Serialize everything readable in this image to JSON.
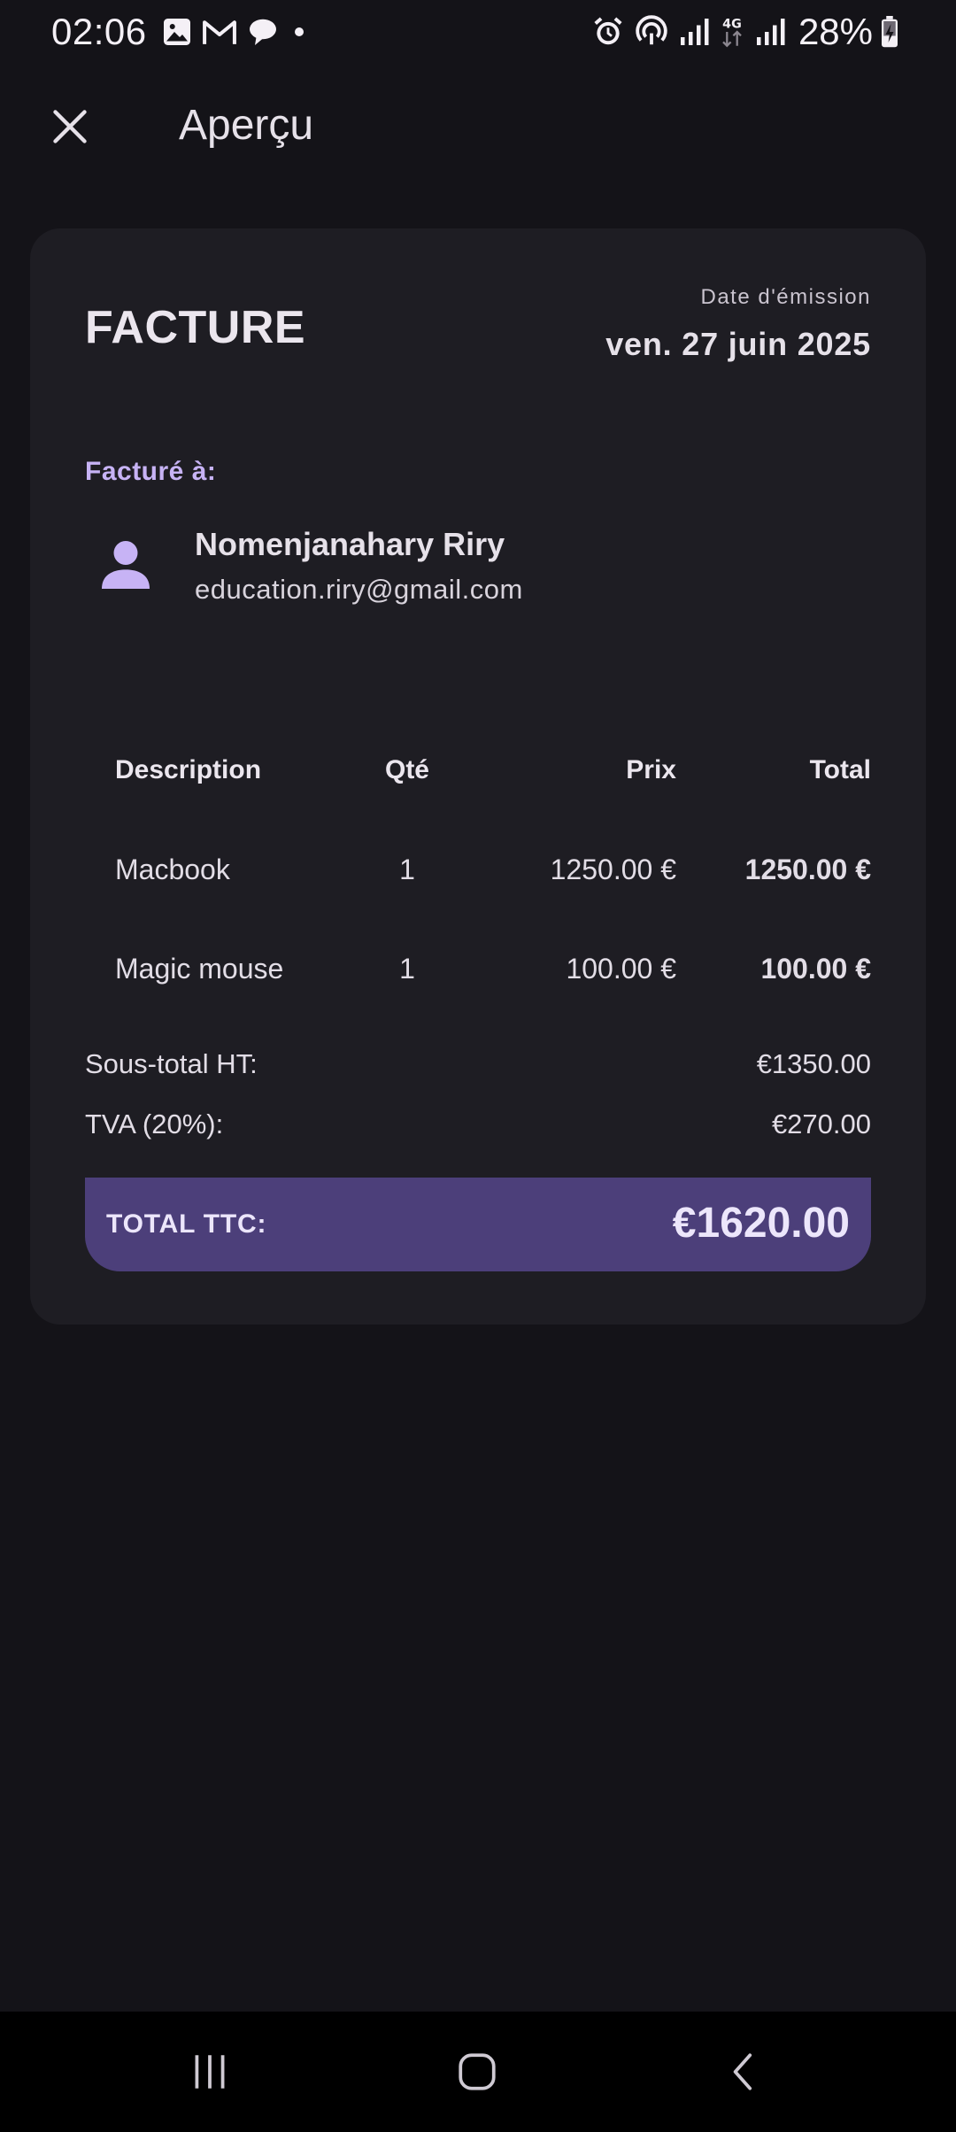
{
  "status_bar": {
    "time": "02:06",
    "battery": "28%",
    "network": "4G",
    "left_icons": [
      "image-icon",
      "gmail-icon",
      "chat-icon",
      "dot-icon"
    ],
    "right_icons": [
      "alarm-icon",
      "hotspot-icon",
      "signal-icon",
      "network-4g-icon",
      "signal-icon",
      "battery-charging-icon"
    ]
  },
  "app_bar": {
    "title": "Aperçu",
    "close_icon": "close-icon"
  },
  "invoice": {
    "heading": "FACTURE",
    "date_label": "Date d'émission",
    "date_value": "ven. 27 juin 2025",
    "billed_to_label": "Facturé à:",
    "client": {
      "name": "Nomenjanahary Riry",
      "email": "education.riry@gmail.com",
      "avatar_icon": "person-icon"
    },
    "table": {
      "headers": {
        "description": "Description",
        "qty": "Qté",
        "price": "Prix",
        "total": "Total"
      },
      "rows": [
        {
          "description": "Macbook",
          "qty": "1",
          "price": "1250.00 €",
          "total": "1250.00 €"
        },
        {
          "description": "Magic mouse",
          "qty": "1",
          "price": "100.00 €",
          "total": "100.00 €"
        }
      ]
    },
    "summary": {
      "subtotal_label": "Sous-total HT:",
      "subtotal_value": "€1350.00",
      "vat_label": "TVA (20%):",
      "vat_value": "€270.00",
      "total_label": "TOTAL TTC:",
      "total_value": "€1620.00"
    }
  },
  "nav_bar": {
    "icons": [
      "recents-icon",
      "home-icon",
      "back-icon"
    ]
  },
  "colors": {
    "background": "#141318",
    "card": "#1e1d23",
    "accent": "#c7b3f5",
    "total_bar": "#4c3f7a"
  }
}
